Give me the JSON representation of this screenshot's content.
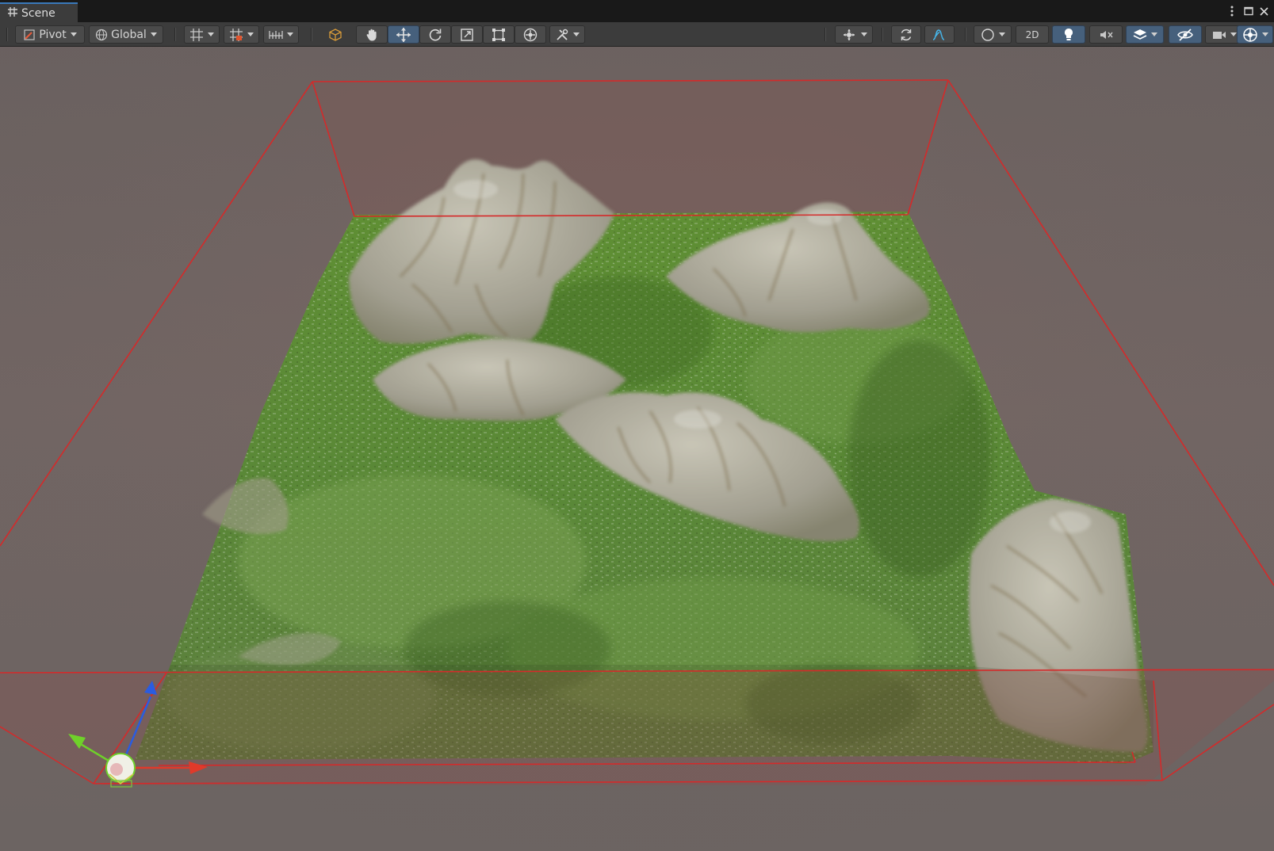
{
  "window": {
    "tab_title": "Scene",
    "tab_icon": "scene-grid-icon",
    "menu_icon": "more-vertical-icon",
    "maximize_icon": "maximize-icon",
    "close_icon": "close-icon"
  },
  "toolbar": {
    "pivot_label": "Pivot",
    "global_label": "Global",
    "mode_2d_label": "2D",
    "tools": [
      "view-tool-hand-icon",
      "move-tool-icon",
      "rotate-tool-icon",
      "scale-tool-icon",
      "rect-tool-icon",
      "transform-tool-icon",
      "custom-editor-tool-icon"
    ],
    "active_tool": "move-tool-icon",
    "colors": {
      "toolbar_bg": "#3c3c3c",
      "button_bg": "#4a4a4a",
      "button_active": "#46607c",
      "accent": "#3a79bb"
    }
  },
  "scene": {
    "colors": {
      "sky": "#6e6462",
      "terrain_bounds": "#d42a2a",
      "grass": "#5e8a3a",
      "rock": "#a7a395",
      "gizmo_x": "#e03a2a",
      "gizmo_y": "#6fd12a",
      "gizmo_z": "#2a5ce0"
    }
  }
}
